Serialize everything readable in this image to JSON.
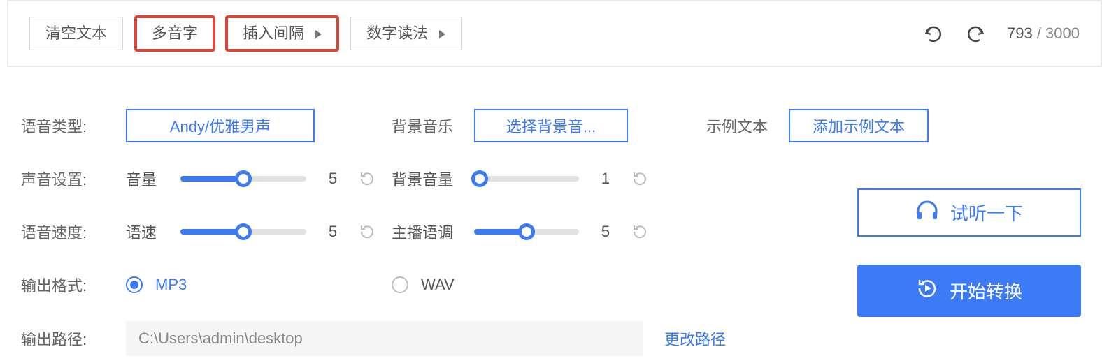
{
  "toolbar": {
    "clear_label": "清空文本",
    "polyphone_label": "多音字",
    "insert_gap_label": "插入间隔",
    "number_read_label": "数字读法",
    "char_count": "793",
    "char_max": "3000"
  },
  "voice_type": {
    "label": "语音类型:",
    "value": "Andy/优雅男声"
  },
  "bgm": {
    "label": "背景音乐",
    "button": "选择背景音..."
  },
  "sample": {
    "label": "示例文本",
    "button": "添加示例文本"
  },
  "sound_setting_label": "声音设置:",
  "volume": {
    "label": "音量",
    "value": 5,
    "max": 10
  },
  "bg_volume": {
    "label": "背景音量",
    "value": 1,
    "max": 10
  },
  "speed_row_label": "语音速度:",
  "speed": {
    "label": "语速",
    "value": 5,
    "max": 10
  },
  "pitch": {
    "label": "主播语调",
    "value": 5,
    "max": 10
  },
  "output_format": {
    "label": "输出格式:",
    "mp3": "MP3",
    "wav": "WAV",
    "selected": "mp3"
  },
  "output_path": {
    "label": "输出路径:",
    "value": "C:\\Users\\admin\\desktop",
    "change_label": "更改路径"
  },
  "preview_label": "试听一下",
  "convert_label": "开始转换"
}
